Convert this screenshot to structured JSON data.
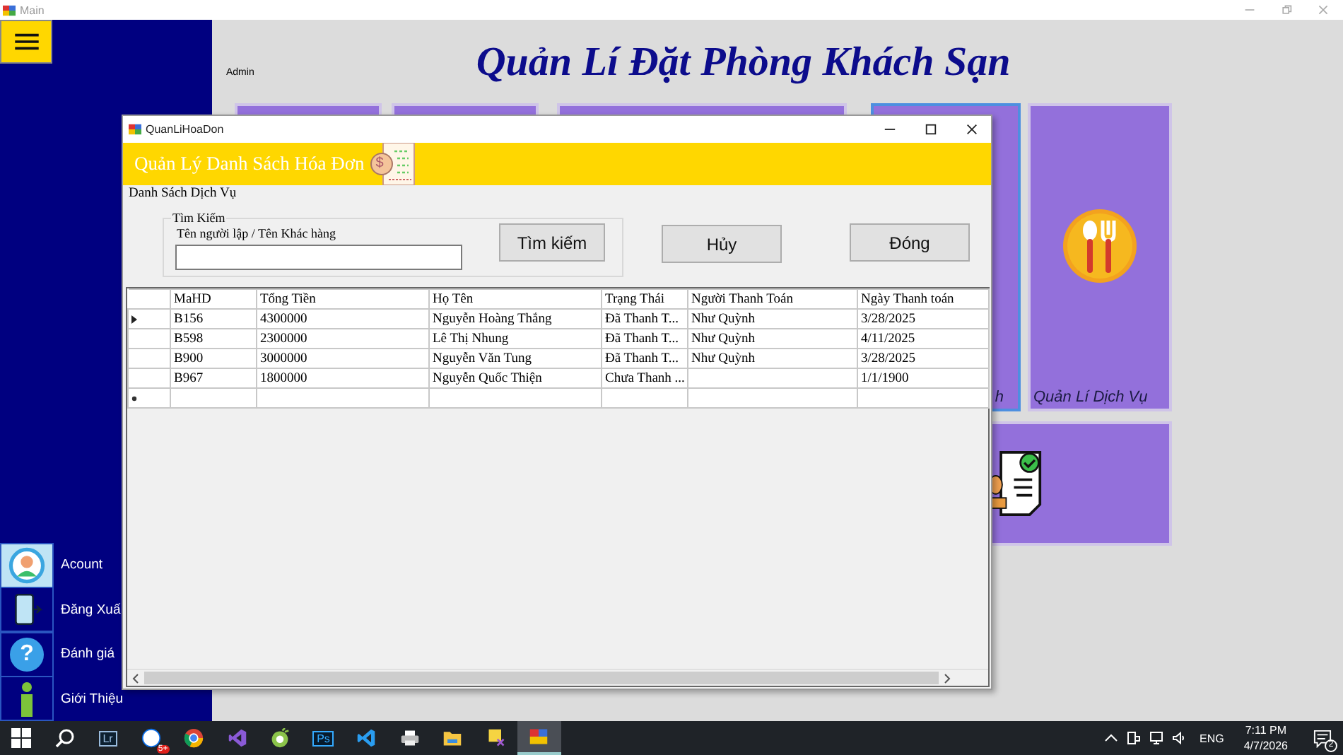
{
  "main_window": {
    "title": "Main",
    "user_label": "Admin",
    "heading": "Quản Lí Đặt Phòng Khách Sạn"
  },
  "sidebar": {
    "items": [
      {
        "kind": "account",
        "label": "Acount"
      },
      {
        "kind": "logout",
        "label": "Đăng Xuấ"
      },
      {
        "kind": "help",
        "label": "Đánh giá",
        "icon_glyph": "?"
      },
      {
        "kind": "info",
        "label": "Giới Thiệu"
      }
    ]
  },
  "tile_rows": [
    [
      {
        "kind": "blank",
        "selected": false
      },
      {
        "kind": "blank",
        "selected": false
      },
      {
        "kind": "blank",
        "selected": false
      },
      {
        "kind": "blank",
        "label": "h",
        "selected": true
      },
      {
        "kind": "food",
        "label": "Quản Lí Dịch Vụ",
        "selected": false
      }
    ],
    [
      {
        "kind": "certificate",
        "selected": false
      }
    ]
  ],
  "dialog": {
    "title": "QuanLiHoaDon",
    "banner": "Quản Lý Danh Sách Hóa Đơn",
    "banner_icon_glyph": "$",
    "section_label": "Danh Sách Dịch Vụ",
    "search_group": {
      "title": "Tìm Kiếm",
      "field_label": "Tên người lập / Tên Khác hàng"
    },
    "buttons": [
      "Tìm kiếm",
      "Hủy",
      "Đóng"
    ],
    "table": {
      "columns": [
        "MaHD",
        "Tổng Tiền",
        "Họ Tên",
        "Trạng Thái",
        "Người Thanh Toán",
        "Ngày Thanh toán"
      ],
      "rows": [
        {
          "selected": true,
          "cells": [
            "B156",
            "4300000",
            "Nguyễn Hoàng Thắng",
            "Đã Thanh T...",
            "Như Quỳnh",
            "3/28/2025"
          ]
        },
        {
          "selected": false,
          "cells": [
            "B598",
            "2300000",
            "Lê Thị Nhung",
            "Đã Thanh T...",
            "Như Quỳnh",
            "4/11/2025"
          ]
        },
        {
          "selected": false,
          "cells": [
            "B900",
            "3000000",
            "Nguyễn Văn Tung",
            "Đã Thanh T...",
            "Như Quỳnh",
            "3/28/2025"
          ]
        },
        {
          "selected": false,
          "cells": [
            "B967",
            "1800000",
            "Nguyễn Quốc Thiện",
            "Chưa Thanh ...",
            "",
            "1/1/1900"
          ]
        }
      ],
      "new_row": true
    }
  },
  "taskbar": {
    "apps": [
      {
        "kind": "lightroom",
        "label": "Lr",
        "selected": false
      },
      {
        "kind": "chat",
        "badge": "5+",
        "selected": false
      },
      {
        "kind": "chrome",
        "selected": false
      },
      {
        "kind": "visual-studio",
        "selected": false
      },
      {
        "kind": "green",
        "selected": false
      },
      {
        "kind": "photoshop",
        "label": "Ps",
        "selected": false
      },
      {
        "kind": "vscode",
        "selected": false
      },
      {
        "kind": "printer",
        "selected": false
      },
      {
        "kind": "folder",
        "selected": false
      },
      {
        "kind": "sticky",
        "selected": false
      },
      {
        "kind": "app",
        "selected": true
      }
    ],
    "tray": {
      "language": "ENG",
      "time": "7:11 PM",
      "date": "4/7/2026",
      "notification_count": "2"
    }
  }
}
